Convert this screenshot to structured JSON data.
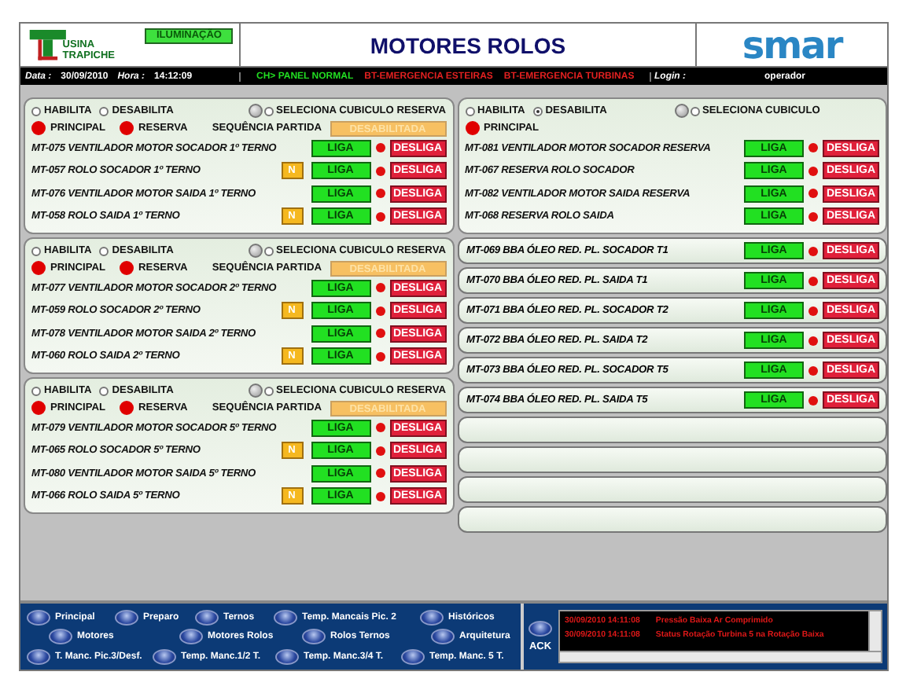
{
  "header": {
    "plant": "USINA TRAPICHE",
    "lighting_button": "ILUMINAÇÃO",
    "title": "MOTORES ROLOS",
    "brand": "smar"
  },
  "status_bar": {
    "date_label": "Data :",
    "date": "30/09/2010",
    "time_label": "Hora :",
    "time": "14:12:09",
    "messages": [
      {
        "text": "CH> PANEL NORMAL",
        "color": "#22dd22"
      },
      {
        "text": "BT-EMERGENCIA ESTEIRAS",
        "color": "#e02020"
      },
      {
        "text": "BT-EMERGENCIA TURBINAS",
        "color": "#e02020"
      }
    ],
    "login_label": "Login :",
    "user": "operador"
  },
  "left_groups": [
    {
      "habilita": {
        "label": "HABILITA",
        "selected": false
      },
      "desabilita": {
        "label": "DESABILITA",
        "selected": false
      },
      "selector": {
        "label": "SELECIONA CUBICULO RESERVA",
        "selected": false
      },
      "lamps": [
        {
          "label": "PRINCIPAL",
          "on": true
        },
        {
          "label": "RESERVA",
          "on": true
        }
      ],
      "sequence_label": "SEQUÊNCIA PARTIDA",
      "sequence_value": "DESABILITADA",
      "motors": [
        {
          "name": "MT-075 VENTILADOR MOTOR SOCADOR 1º TERNO",
          "liga": "LIGA",
          "desliga": "DESLIGA"
        },
        {
          "name": "MT-057 ROLO SOCADOR 1º TERNO",
          "n_button": "N",
          "liga": "LIGA",
          "desliga": "DESLIGA"
        },
        {
          "name": "MT-076 VENTILADOR MOTOR SAIDA 1º TERNO",
          "liga": "LIGA",
          "desliga": "DESLIGA"
        },
        {
          "name": "MT-058 ROLO SAIDA 1º TERNO",
          "n_button": "N",
          "liga": "LIGA",
          "desliga": "DESLIGA"
        }
      ]
    },
    {
      "habilita": {
        "label": "HABILITA",
        "selected": false
      },
      "desabilita": {
        "label": "DESABILITA",
        "selected": false
      },
      "selector": {
        "label": "SELECIONA CUBICULO RESERVA",
        "selected": false
      },
      "lamps": [
        {
          "label": "PRINCIPAL",
          "on": true
        },
        {
          "label": "RESERVA",
          "on": true
        }
      ],
      "sequence_label": "SEQUÊNCIA PARTIDA",
      "sequence_value": "DESABILITADA",
      "motors": [
        {
          "name": "MT-077 VENTILADOR MOTOR SOCADOR 2º TERNO",
          "liga": "LIGA",
          "desliga": "DESLIGA"
        },
        {
          "name": "MT-059 ROLO SOCADOR 2º TERNO",
          "n_button": "N",
          "liga": "LIGA",
          "desliga": "DESLIGA"
        },
        {
          "name": "MT-078 VENTILADOR MOTOR SAIDA 2º TERNO",
          "liga": "LIGA",
          "desliga": "DESLIGA"
        },
        {
          "name": "MT-060 ROLO SAIDA 2º TERNO",
          "n_button": "N",
          "liga": "LIGA",
          "desliga": "DESLIGA"
        }
      ]
    },
    {
      "habilita": {
        "label": "HABILITA",
        "selected": false
      },
      "desabilita": {
        "label": "DESABILITA",
        "selected": false
      },
      "selector": {
        "label": "SELECIONA CUBICULO RESERVA",
        "selected": false
      },
      "lamps": [
        {
          "label": "PRINCIPAL",
          "on": true
        },
        {
          "label": "RESERVA",
          "on": true
        }
      ],
      "sequence_label": "SEQUÊNCIA PARTIDA",
      "sequence_value": "DESABILITADA",
      "motors": [
        {
          "name": "MT-079 VENTILADOR MOTOR SOCADOR 5º TERNO",
          "liga": "LIGA",
          "desliga": "DESLIGA"
        },
        {
          "name": "MT-065 ROLO SOCADOR 5º TERNO",
          "n_button": "N",
          "liga": "LIGA",
          "desliga": "DESLIGA"
        },
        {
          "name": "MT-080 VENTILADOR MOTOR SAIDA 5º TERNO",
          "liga": "LIGA",
          "desliga": "DESLIGA"
        },
        {
          "name": "MT-066 ROLO SAIDA 5º TERNO",
          "n_button": "N",
          "liga": "LIGA",
          "desliga": "DESLIGA"
        }
      ]
    }
  ],
  "reserve_group": {
    "habilita": {
      "label": "HABILITA",
      "selected": false
    },
    "desabilita": {
      "label": "DESABILITA",
      "selected": true
    },
    "selector": {
      "label": "SELECIONA CUBICULO",
      "selected": false
    },
    "lamps": [
      {
        "label": "PRINCIPAL",
        "on": true
      }
    ],
    "motors": [
      {
        "name": "MT-081 VENTILADOR MOTOR SOCADOR RESERVA",
        "liga": "LIGA",
        "desliga": "DESLIGA"
      },
      {
        "name": "MT-067 RESERVA ROLO SOCADOR",
        "liga": "LIGA",
        "desliga": "DESLIGA"
      },
      {
        "name": "MT-082 VENTILADOR MOTOR SAIDA RESERVA",
        "liga": "LIGA",
        "desliga": "DESLIGA"
      },
      {
        "name": "MT-068 RESERVA ROLO SAIDA",
        "liga": "LIGA",
        "desliga": "DESLIGA"
      }
    ]
  },
  "pump_rows": [
    {
      "kind": "motor",
      "name": "MT-069 BBA ÓLEO RED. PL. SOCADOR T1",
      "liga": "LIGA",
      "desliga": "DESLIGA"
    },
    {
      "kind": "motor",
      "name": "MT-070 BBA ÓLEO RED. PL. SAIDA T1",
      "liga": "LIGA",
      "desliga": "DESLIGA"
    },
    {
      "kind": "motor",
      "name": "MT-071 BBA ÓLEO RED. PL. SOCADOR T2",
      "liga": "LIGA",
      "desliga": "DESLIGA"
    },
    {
      "kind": "motor",
      "name": "MT-072 BBA ÓLEO RED. PL. SAIDA T2",
      "liga": "LIGA",
      "desliga": "DESLIGA"
    },
    {
      "kind": "motor",
      "name": "MT-073 BBA ÓLEO RED. PL. SOCADOR T5",
      "liga": "LIGA",
      "desliga": "DESLIGA"
    },
    {
      "kind": "motor",
      "name": "MT-074 BBA ÓLEO RED. PL. SAIDA T5",
      "liga": "LIGA",
      "desliga": "DESLIGA"
    },
    {
      "kind": "empty"
    },
    {
      "kind": "empty"
    },
    {
      "kind": "empty"
    },
    {
      "kind": "empty"
    }
  ],
  "nav": {
    "buttons": [
      "Principal",
      "Preparo",
      "Ternos",
      "Temp. Mancais Pic. 2",
      "Históricos",
      "Motores",
      "Motores Rolos",
      "Rolos Ternos",
      "Arquitetura",
      "T. Manc. Pic.3/Desf.",
      "Temp. Manc.1/2 T.",
      "Temp. Manc.3/4 T.",
      "Temp. Manc. 5 T."
    ],
    "ack": "ACK",
    "alarms": [
      {
        "time": "30/09/2010 14:11:08",
        "text": "Pressão Baixa Ar Comprimido"
      },
      {
        "time": "30/09/2010 14:11:08",
        "text": "Status Rotação Turbina 5 na Rotação Baixa"
      }
    ]
  }
}
